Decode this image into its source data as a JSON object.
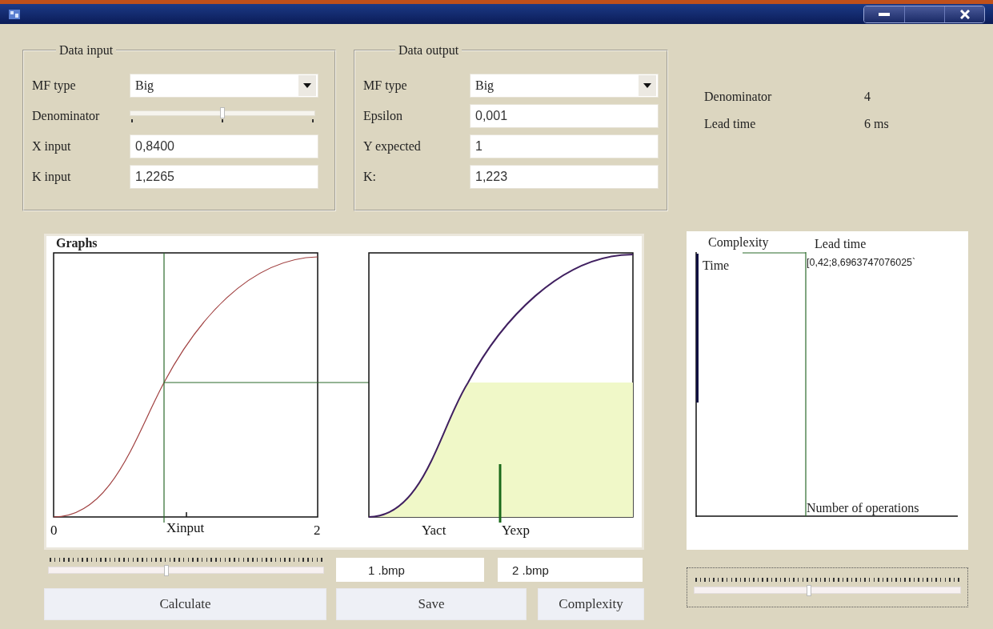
{
  "data_input": {
    "title": "Data input",
    "fields": [
      {
        "kind": "dropdown",
        "label": "MF type",
        "value": "Big"
      },
      {
        "kind": "slider",
        "label": "Denominator",
        "level": 0.5
      },
      {
        "kind": "text",
        "label": "X input",
        "value": "0,8400"
      },
      {
        "kind": "text",
        "label": "K input",
        "value": "1,2265"
      }
    ]
  },
  "data_output": {
    "title": "Data output",
    "fields": [
      {
        "kind": "dropdown",
        "label": "MF type",
        "value": "Big"
      },
      {
        "kind": "text",
        "label": "Epsilon",
        "value": "0,001"
      },
      {
        "kind": "text",
        "label": "Y expected",
        "value": "1"
      },
      {
        "kind": "text",
        "label": "K:",
        "value": "1,223"
      }
    ]
  },
  "summary": [
    {
      "label": "Denominator",
      "value": "4"
    },
    {
      "label": "Lead time",
      "value": "6 ms"
    }
  ],
  "graphs": {
    "title": "Graphs",
    "left_labels": [
      "0",
      "Xinput",
      "2"
    ],
    "right_labels": [
      "Yact",
      "Yexp"
    ]
  },
  "complexity": {
    "headers": [
      "Complexity",
      "Lead time"
    ],
    "y_label": "Time",
    "value": "[0,42;8,6963747076025`",
    "x_label": "Number of operations"
  },
  "graph_slider": {
    "level": 0.43
  },
  "files": [
    "1 .bmp",
    "2 .bmp"
  ],
  "buttons": [
    "Calculate",
    "Save",
    "Complexity"
  ],
  "complexity_slider": {
    "level": 0.43
  }
}
